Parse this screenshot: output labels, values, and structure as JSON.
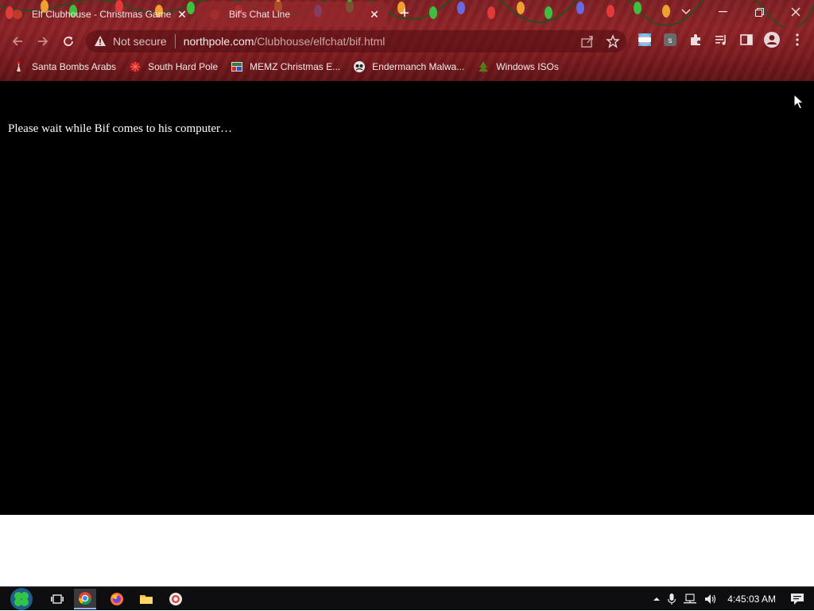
{
  "browser": {
    "tabs": [
      {
        "title": "Elf Clubhouse - Christmas Game",
        "active": false
      },
      {
        "title": "Bif's Chat Line",
        "active": true
      }
    ],
    "address": {
      "security_label": "Not secure",
      "host": "northpole.com",
      "path": "/Clubhouse/elfchat/bif.html"
    },
    "bookmarks": [
      {
        "label": "Santa Bombs Arabs",
        "icon": "santa-icon"
      },
      {
        "label": "South Hard Pole",
        "icon": "snowflake-icon"
      },
      {
        "label": "MEMZ Christmas E...",
        "icon": "memz-icon"
      },
      {
        "label": "Endermanch Malwa...",
        "icon": "endermanch-icon"
      },
      {
        "label": "Windows ISOs",
        "icon": "tree-icon"
      }
    ]
  },
  "page": {
    "message": "Please wait while Bif comes to his computer…",
    "background": "#000000"
  },
  "taskbar": {
    "time": "4:45:03 AM",
    "apps": [
      "chrome-icon",
      "firefox-icon",
      "file-explorer-icon",
      "chrome-alt-icon"
    ]
  },
  "colors": {
    "chrome_red": "#8c2226",
    "page_bg": "#000000",
    "taskbar_bg": "#0e0e10"
  }
}
